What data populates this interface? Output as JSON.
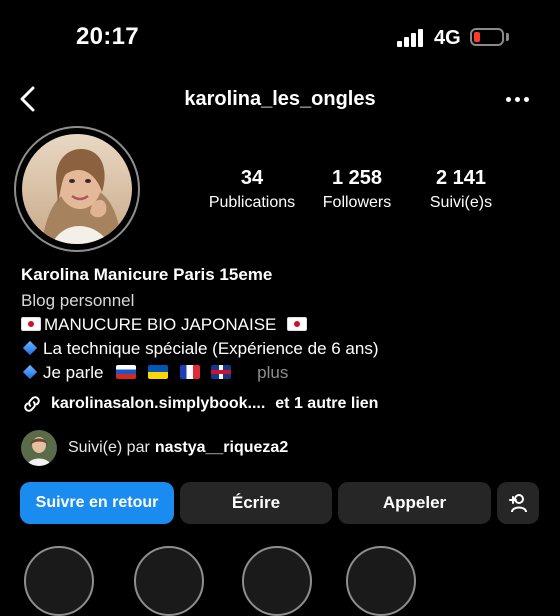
{
  "status_bar": {
    "time": "20:17",
    "network": "4G",
    "battery_level": 0.15,
    "battery_color": "#ff3b30"
  },
  "header": {
    "username": "karolina_les_ongles",
    "back_icon": "chevron-left-icon",
    "more_icon": "ellipsis-icon"
  },
  "stats": [
    {
      "value": "34",
      "label": "Publications"
    },
    {
      "value": "1 258",
      "label": "Followers"
    },
    {
      "value": "2 141",
      "label": "Suivi(e)s"
    }
  ],
  "bio": {
    "name": "Karolina Manicure Paris 15eme",
    "category": "Blog personnel",
    "line1": "MANUCURE BIO JAPONAISE",
    "line2": "La technique spéciale (Expérience de 6 ans)",
    "line3": "Je parle",
    "more": "plus"
  },
  "link": {
    "url": "karolinasalon.simplybook....",
    "extra": "et 1 autre lien"
  },
  "followed_by": {
    "prefix": "Suivi(e) par",
    "user": "nastya__riqueza2"
  },
  "buttons": {
    "follow_back": "Suivre en retour",
    "message": "Écrire",
    "call": "Appeler",
    "add_user_icon": "add-user-icon"
  },
  "colors": {
    "background": "#000000",
    "primary_button": "#1a8cf0",
    "secondary_button": "#262626",
    "muted_text": "#8e8e8e"
  }
}
